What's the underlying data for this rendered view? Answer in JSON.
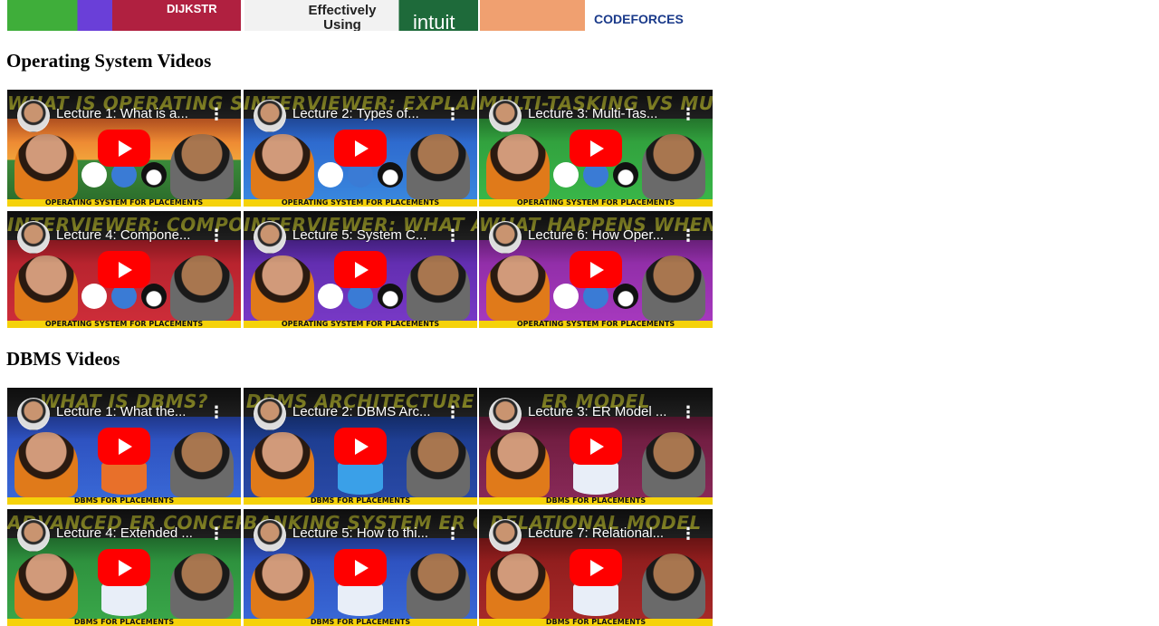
{
  "top_row": {
    "tiles": [
      {
        "text": "DIJKSTR",
        "bg": "linear-gradient(90deg,#3fae3a 0%,#3fae3a 30%,#6a3fd8 30%,#6a3fd8 45%,#b02040 45%)",
        "color": "#ffffff"
      },
      {
        "text": "Effectively Using",
        "bg": "#f2f2f2",
        "color": "#222222"
      },
      {
        "text": "intuit",
        "bg": "#1e6a3a",
        "color": "#ffffff"
      },
      {
        "text": "CODEFORCES",
        "bg": "linear-gradient(90deg,#f0a070 0%,#f0a070 45%,#ffffff 45%)",
        "color": "#1a3a8a"
      }
    ]
  },
  "sections": [
    {
      "title": "Operating System Videos",
      "videos": [
        {
          "title": "Lecture 1: What is a...",
          "banner": "WHAT IS OPERATING SYSTEMS?",
          "strip": "OPERATING SYSTEM FOR PLACEMENTS",
          "bg": "linear-gradient(180deg,#1f1f1f 0%,#2a2a2a 25%,#e86a2a 25%,#f2a33a 60%,#3b8a3a 60%,#2a6a2a 100%)",
          "kind": "os"
        },
        {
          "title": "Lecture 2: Types of...",
          "banner": "INTERVIEWER: EXPLAIN TYPES OF OPERATING SYSTEMS",
          "strip": "OPERATING SYSTEM FOR PLACEMENTS",
          "bg": "linear-gradient(180deg,#1f1f1f 0%,#2a2a2a 25%,#2a5fc8 25%,#3a8ae0 100%)",
          "kind": "os"
        },
        {
          "title": "Lecture 3: Multi-Tas...",
          "banner": "MULTI-TASKING VS MULTI-THREADING",
          "strip": "OPERATING SYSTEM FOR PLACEMENTS",
          "bg": "linear-gradient(180deg,#1f1f1f 0%,#2a2a2a 25%,#2f9a3a 25%,#3ab84a 100%)",
          "kind": "os"
        },
        {
          "title": "Lecture 4: Compone...",
          "banner": "INTERVIEWER: COMPONENTS OF OPERATING SYSTEM",
          "strip": "OPERATING SYSTEM FOR PLACEMENTS",
          "bg": "linear-gradient(180deg,#1f1f1f 0%,#2a2a2a 25%,#b0202a 25%,#cf2e3a 100%)",
          "kind": "os"
        },
        {
          "title": "Lecture 5: System C...",
          "banner": "INTERVIEWER: WHAT ARE SYSTEM CALLS IN OPERATING SYSTEM?",
          "strip": "OPERATING SYSTEM FOR PLACEMENTS",
          "bg": "linear-gradient(180deg,#1f1f1f 0%,#2a2a2a 25%,#5a2aa8 25%,#7a3ac8 100%)",
          "kind": "os"
        },
        {
          "title": "Lecture 6: How Oper...",
          "banner": "WHAT HAPPENS WHEN YOU TURN ON YOUR COMPUTER?",
          "strip": "OPERATING SYSTEM FOR PLACEMENTS",
          "bg": "linear-gradient(180deg,#1f1f1f 0%,#2a2a2a 25%,#8a2aa0 25%,#a83ac0 100%)",
          "kind": "os"
        }
      ]
    },
    {
      "title": "DBMS Videos",
      "videos": [
        {
          "title": "Lecture 1: What the...",
          "banner": "WHAT IS DBMS?",
          "strip": "DBMS FOR PLACEMENTS",
          "bg": "linear-gradient(180deg,#1f1f1f 0%,#2a2a2a 25%,#2a4ab8 25%,#3a6ad8 100%)",
          "kind": "dbms",
          "db": "#e8702a"
        },
        {
          "title": "Lecture 2: DBMS Arc...",
          "banner": "DBMS ARCHITECTURE",
          "strip": "DBMS FOR PLACEMENTS",
          "bg": "linear-gradient(180deg,#1f1f1f 0%,#2a2a2a 25%,#1a3a8a 25%,#2a4aa8 100%)",
          "kind": "dbms",
          "db": "#3aa0e8"
        },
        {
          "title": "Lecture 3: ER Model ...",
          "banner": "ER MODEL",
          "strip": "DBMS FOR PLACEMENTS",
          "bg": "linear-gradient(180deg,#1f1f1f 0%,#2a2a2a 25%,#6a1a3a 25%,#8a2a5a 100%)",
          "kind": "dbms",
          "db": "#e8eef8"
        },
        {
          "title": "Lecture 4: Extended ...",
          "banner": "ADVANCED ER CONCEPTS",
          "strip": "DBMS FOR PLACEMENTS",
          "bg": "linear-gradient(180deg,#1f1f1f 0%,#2a2a2a 25%,#2a8a3a 25%,#3aa84a 100%)",
          "kind": "dbms",
          "db": "#e8eef8"
        },
        {
          "title": "Lecture 5: How to thi...",
          "banner": "BANKING SYSTEM ER CONCEPTS",
          "strip": "DBMS FOR PLACEMENTS",
          "bg": "linear-gradient(180deg,#1f1f1f 0%,#2a2a2a 25%,#2a4ab8 25%,#3a6ad8 100%)",
          "kind": "dbms",
          "db": "#e8eef8"
        },
        {
          "title": "Lecture 7: Relational...",
          "banner": "RELATIONAL MODEL",
          "strip": "DBMS FOR PLACEMENTS",
          "bg": "linear-gradient(180deg,#1f1f1f 0%,#2a2a2a 25%,#8a1a1a 25%,#a82a2a 100%)",
          "kind": "dbms",
          "db": "#e8eef8"
        }
      ]
    }
  ]
}
